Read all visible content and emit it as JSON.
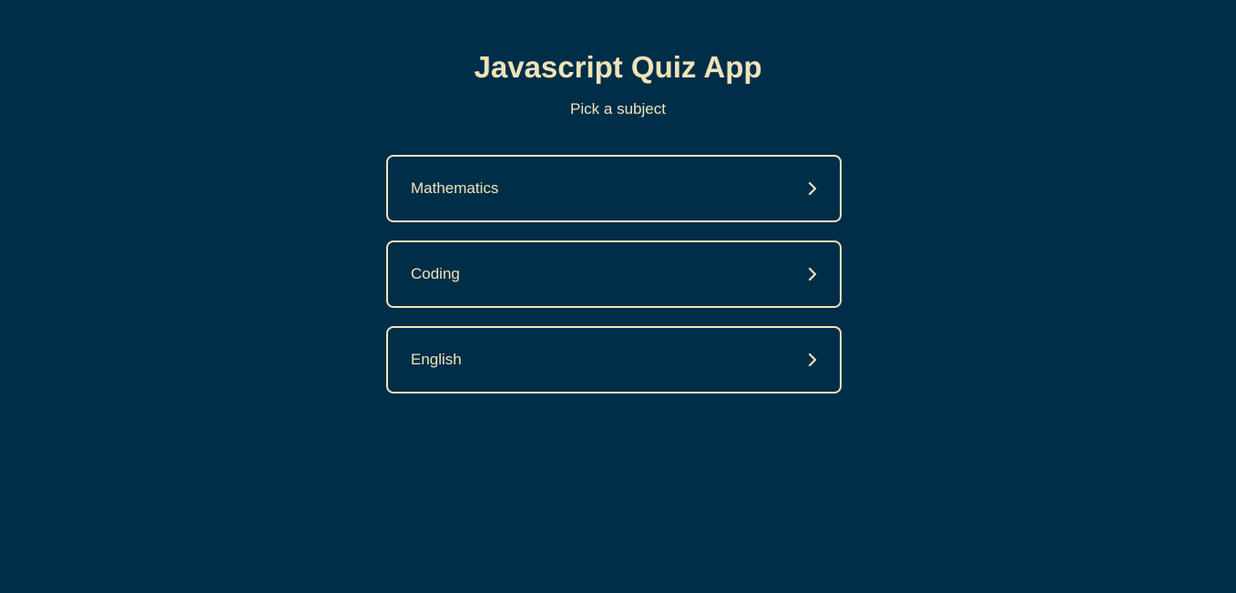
{
  "header": {
    "title": "Javascript Quiz App",
    "subtitle": "Pick a subject"
  },
  "subjects": [
    {
      "label": "Mathematics",
      "icon": "chevron-right-icon"
    },
    {
      "label": "Coding",
      "icon": "chevron-right-icon"
    },
    {
      "label": "English",
      "icon": "chevron-right-icon"
    }
  ],
  "colors": {
    "background": "#002e48",
    "accent": "#f1e3b8"
  }
}
